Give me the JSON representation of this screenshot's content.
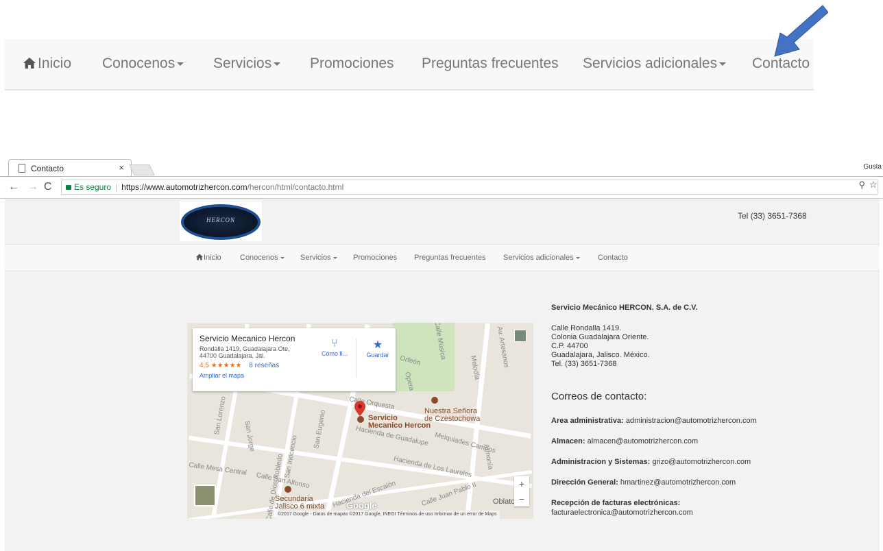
{
  "top_nav": {
    "items": [
      {
        "label": "Inicio"
      },
      {
        "label": "Conocenos"
      },
      {
        "label": "Servicios"
      },
      {
        "label": "Promociones"
      },
      {
        "label": "Preguntas frecuentes"
      },
      {
        "label": "Servicios adicionales"
      },
      {
        "label": "Contacto"
      }
    ]
  },
  "browser": {
    "tab_title": "Contacto",
    "tab_close": "×",
    "profile_label": "Gusta",
    "security_label": "Es seguro",
    "url_host": "https://www.automotrizhercon.com",
    "url_path": "/hercon/html/contacto.html"
  },
  "site": {
    "logo_text": "HERCON",
    "phone": "Tel (33) 3651-7368",
    "nav": [
      {
        "label": "Inicio"
      },
      {
        "label": "Conocenos"
      },
      {
        "label": "Servicios"
      },
      {
        "label": "Promociones"
      },
      {
        "label": "Preguntas frecuentes"
      },
      {
        "label": "Servicios adicionales"
      },
      {
        "label": "Contacto"
      }
    ]
  },
  "map": {
    "place_name": "Servicio Mecanico Hercon",
    "address_line1": "Rondalla 1419, Guadalajara Ote,",
    "address_line2": "44700 Guadalajara, Jal.",
    "rating": "4,5",
    "stars": "★★★★★",
    "reviews": "8 reseñas",
    "enlarge": "Ampliar el mapa",
    "directions": "Cómo ll...",
    "save": "Guardar",
    "pin_label_1": "Servicio",
    "pin_label_2": "Mecanico Hercon",
    "church_1": "Nuestra Señora",
    "church_2": "de Czestochowa",
    "school_1": "Secundaria",
    "school_2": "Jalisco 6 mixta",
    "oblato": "Oblato",
    "streets": {
      "orquesta": "Calle Orquesta",
      "opera": "Ópera",
      "hacienda_guadalupe": "Hacienda de Guadalupe",
      "melquiades": "Melquiades Campos",
      "hacienda_laureles": "Hacienda de Los Laureles",
      "hacienda_escalon": "Hacienda del Escalón",
      "mesa_central": "Calle Mesa Central",
      "san_alfonso": "Calle San Alfonso",
      "san_jorge": "San Jorge",
      "san_inocencio": "San Inocencio",
      "san_eugenio": "San Eugenio",
      "san_lorenzo": "San Lorenzo",
      "dios_robledo": "Calle de Dios Robledo",
      "juan_pablo": "Calle Juan Pablo II",
      "melodia": "Melodía",
      "armonia": "Armonía",
      "artesanos": "Av. Artesanos",
      "musica": "Calle Música",
      "orfeon": "Orfeón"
    },
    "footer": "©2017 Google - Datos de mapas ©2017 Google, INEGI    Términos de uso    Informar de un error de Maps",
    "google": "Google",
    "zoom_in": "+",
    "zoom_out": "−"
  },
  "contact": {
    "company": "Servicio Mecánico HERCON. S.A. de C.V.",
    "address": [
      "Calle Rondalla 1419.",
      "Colonia Guadalajara Oriente.",
      "C.P. 44700",
      "Guadalajara, Jalisco. México.",
      "Tel. (33) 3651-7368"
    ],
    "emails_title": "Correos de contacto:",
    "emails": [
      {
        "label": "Area administrativa:",
        "value": "administracion@automotrizhercon.com"
      },
      {
        "label": "Almacen:",
        "value": "almacen@automotrizhercon.com"
      },
      {
        "label": "Administracion y Sistemas:",
        "value": "grizo@automotrizhercon.com"
      },
      {
        "label": "Dirección General:",
        "value": "hmartinez@automotrizhercon.com"
      },
      {
        "label": "Recepción de facturas electrónicas:",
        "value": "facturaelectronica@automotrizhercon.com"
      }
    ]
  },
  "colors": {
    "arrow": "#4472c4",
    "accent_link": "#3a67c8",
    "pin": "#d9372b",
    "secure_green": "#0b8043"
  }
}
